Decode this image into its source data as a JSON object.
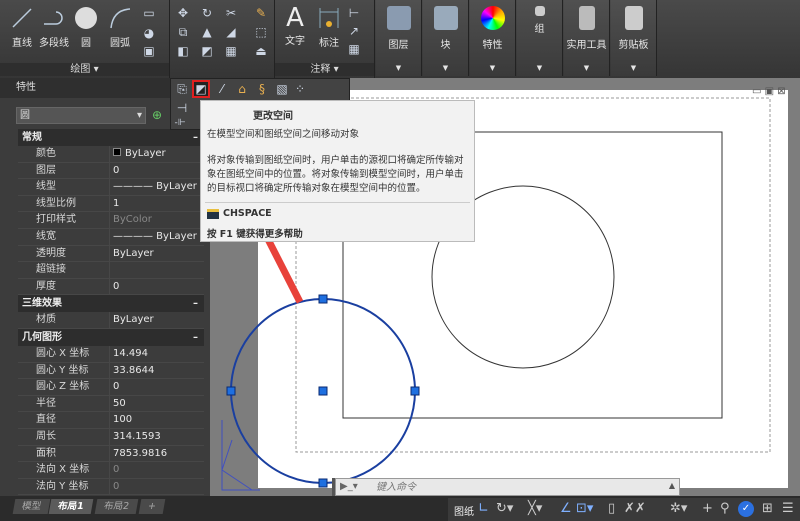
{
  "ribbon": {
    "draw": {
      "items": [
        "直线",
        "多段线",
        "圆",
        "圆弧"
      ],
      "panel_label": "绘图 ▾"
    },
    "annotate": {
      "items": [
        "文字",
        "标注"
      ],
      "panel_label": "注释 ▾"
    },
    "big_buttons": [
      "图层",
      "块",
      "特性",
      "组",
      "实用工具",
      "剪贴板"
    ]
  },
  "properties": {
    "title": "特性",
    "object_type": "圆",
    "sections": [
      {
        "name": "常规",
        "rows": [
          [
            "颜色",
            "ByLayer"
          ],
          [
            "图层",
            "0"
          ],
          [
            "线型",
            "———— ByLayer"
          ],
          [
            "线型比例",
            "1"
          ],
          [
            "打印样式",
            "ByColor"
          ],
          [
            "线宽",
            "———— ByLayer"
          ],
          [
            "透明度",
            "ByLayer"
          ],
          [
            "超链接",
            ""
          ],
          [
            "厚度",
            "0"
          ]
        ]
      },
      {
        "name": "三维效果",
        "rows": [
          [
            "材质",
            "ByLayer"
          ]
        ]
      },
      {
        "name": "几何图形",
        "rows": [
          [
            "圆心 X 坐标",
            "14.494"
          ],
          [
            "圆心 Y 坐标",
            "33.8644"
          ],
          [
            "圆心 Z 坐标",
            "0"
          ],
          [
            "半径",
            "50"
          ],
          [
            "直径",
            "100"
          ],
          [
            "周长",
            "314.1593"
          ],
          [
            "面积",
            "7853.9816"
          ],
          [
            "法向 X 坐标",
            "0"
          ],
          [
            "法向 Y 坐标",
            "0"
          ]
        ]
      }
    ]
  },
  "tooltip": {
    "title": "更改空间",
    "summary": "在模型空间和图纸空间之间移动对象",
    "description": "将对象传输到图纸空间时，用户单击的源视口将确定所传输对象在图纸空间中的位置。将对象传输到模型空间时，用户单击的目标视口将确定所传输对象在模型空间中的位置。",
    "command": "CHSPACE",
    "help": "按 F1 键获得更多帮助"
  },
  "command_line": {
    "placeholder": "键入命令"
  },
  "layout_tabs": [
    "模型",
    "布局1",
    "布局2",
    "+"
  ],
  "active_tab": "布局1",
  "status": {
    "space": "图纸"
  },
  "colors": {
    "highlight": "#e02020",
    "selection": "#1a3fa0",
    "arrow": "#e8423a"
  }
}
